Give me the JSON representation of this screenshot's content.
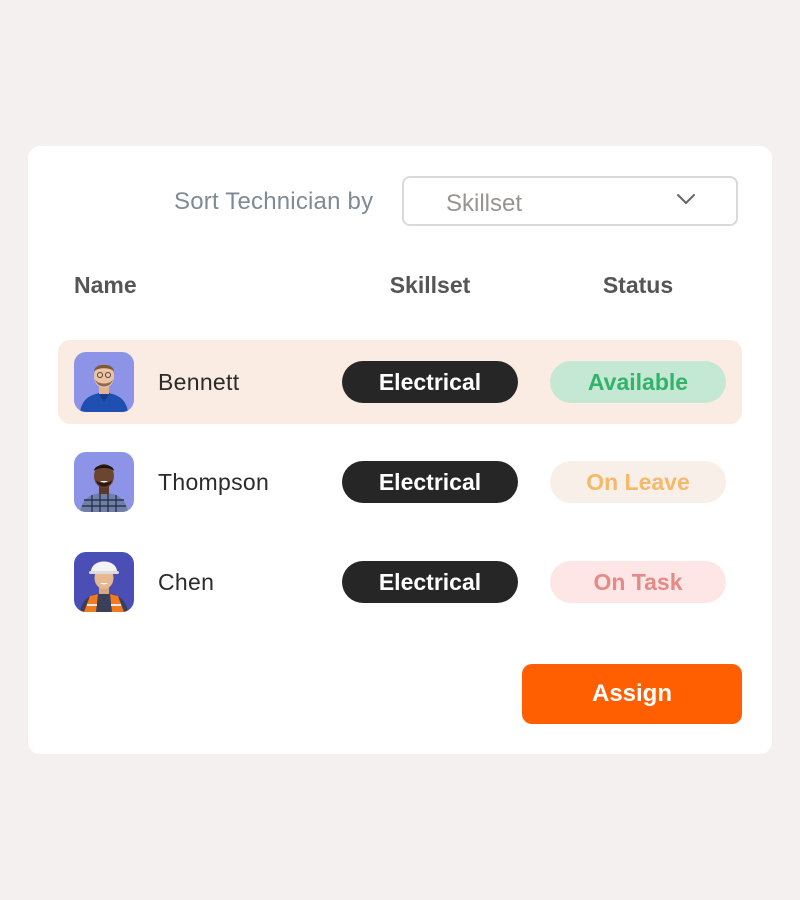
{
  "sort": {
    "label": "Sort Technician by",
    "selected": "Skillset",
    "chevron_icon": "chevron-down-icon"
  },
  "table": {
    "headers": {
      "name": "Name",
      "skillset": "Skillset",
      "status": "Status"
    },
    "rows": [
      {
        "name": "Bennett",
        "skillset": "Electrical",
        "status": "Available",
        "status_color": "#33b26a",
        "selected": true,
        "avatar": "technician-avatar-blue-polo"
      },
      {
        "name": "Thompson",
        "skillset": "Electrical",
        "status": "On Leave",
        "status_color": "#f4b96a",
        "selected": false,
        "avatar": "technician-avatar-plaid-shirt"
      },
      {
        "name": "Chen",
        "skillset": "Electrical",
        "status": "On Task",
        "status_color": "#e48b87",
        "selected": false,
        "avatar": "technician-avatar-hard-hat"
      }
    ]
  },
  "actions": {
    "assign_label": "Assign",
    "accent_color": "#ff5f00"
  }
}
